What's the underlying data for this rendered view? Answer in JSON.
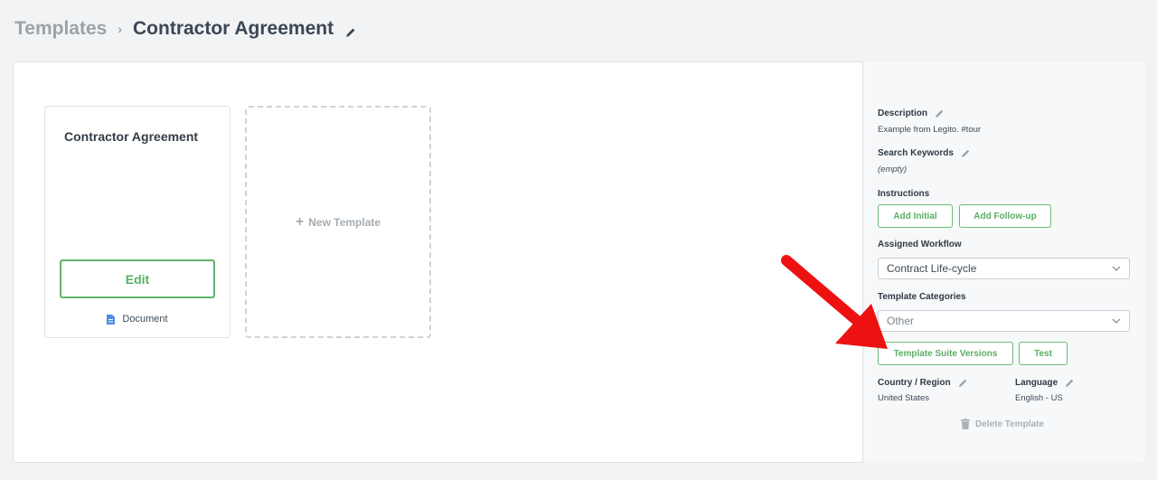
{
  "breadcrumb": {
    "parent": "Templates",
    "separator": "›",
    "current": "Contractor Agreement",
    "edit_icon": "pencil-icon"
  },
  "template_card": {
    "title": "Contractor Agreement",
    "edit_label": "Edit",
    "type_label": "Document",
    "type_icon": "document-icon"
  },
  "new_template": {
    "label": "New Template",
    "icon": "plus-icon"
  },
  "sidebar": {
    "description": {
      "label": "Description",
      "value": "Example from Legito. #tour"
    },
    "search_keywords": {
      "label": "Search Keywords",
      "value": "(empty)"
    },
    "instructions": {
      "label": "Instructions",
      "add_initial": "Add Initial",
      "add_followup": "Add Follow-up"
    },
    "assigned_workflow": {
      "label": "Assigned Workflow",
      "selected": "Contract Life-cycle"
    },
    "template_categories": {
      "label": "Template Categories",
      "selected": "Other"
    },
    "suite_versions_button": "Template Suite Versions",
    "test_button": "Test",
    "country": {
      "label": "Country / Region",
      "value": "United States"
    },
    "language": {
      "label": "Language",
      "value": "English - US"
    },
    "delete_label": "Delete Template"
  },
  "colors": {
    "accent_green": "#5aae63",
    "annotation_arrow": "#ee1111",
    "document_icon": "#4a8fe2"
  }
}
